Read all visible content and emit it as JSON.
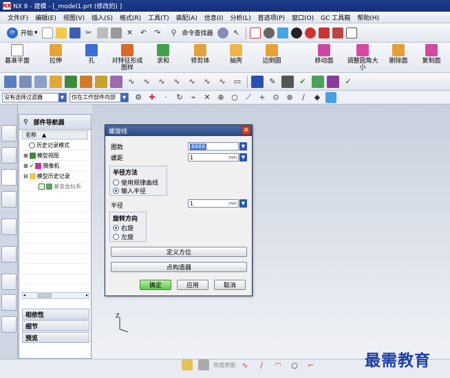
{
  "titlebar": {
    "title": "NX 8 - 建模 - [_model1.prt (修改的) ]"
  },
  "menubar": [
    "文件(F)",
    "编辑(E)",
    "视图(V)",
    "插入(S)",
    "格式(R)",
    "工具(T)",
    "装配(A)",
    "信息(I)",
    "分析(L)",
    "首选项(P)",
    "窗口(O)",
    "GC 工具箱",
    "帮助(H)"
  ],
  "toolbar_standard": {
    "start_label": "开始",
    "command_finder_label": "命令查找器"
  },
  "feature_toolbar": [
    "基准平面",
    "拉伸",
    "孔",
    "对特征形成图样",
    "求和",
    "修剪体",
    "抽壳",
    "边倒圆",
    "移动面",
    "调整圆角大小",
    "删除面",
    "复制面"
  ],
  "selection_bar": {
    "filter_value": "没有选择过滤器",
    "scope_value": "仅在工作部件内部"
  },
  "navigator": {
    "title": "部件导航器",
    "column_header": "名称",
    "tree": [
      "历史记录模式",
      "模型视图",
      "摄像机",
      "模型历史记录",
      "基准坐标系"
    ],
    "sections": [
      "相依性",
      "细节",
      "预览"
    ]
  },
  "dialog": {
    "title": "螺旋线",
    "turns_label": "圈数",
    "turns_value": "8888",
    "pitch_label": "螺距",
    "pitch_value": "1",
    "pitch_unit": "mm",
    "radius_method_title": "半径方法",
    "radius_method_options": [
      "使用规律曲线",
      "输入半径"
    ],
    "radius_label": "半径",
    "radius_value": "1",
    "radius_unit": "mm",
    "rotation_title": "旋转方向",
    "rotation_options": [
      "右旋",
      "左旋"
    ],
    "orient_button": "定义方位",
    "point_button": "点构造器",
    "ok_button": "确定",
    "apply_button": "应用",
    "cancel_button": "取消"
  },
  "axis_label": "Z",
  "sketch_bar": {
    "finish_label": "完成草图"
  },
  "watermark": "最需教育"
}
